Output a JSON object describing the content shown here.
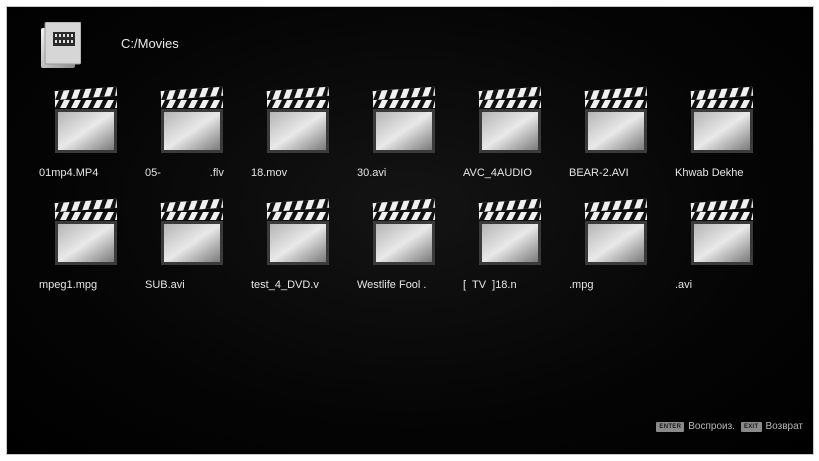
{
  "header": {
    "folder_icon": "folder-video-icon",
    "path": "C:/Movies"
  },
  "files": [
    {
      "name": "01mp4.MP4",
      "icon": "movie-clapperboard-icon"
    },
    {
      "name": "05-                .flv",
      "icon": "movie-clapperboard-icon"
    },
    {
      "name": "18.mov",
      "icon": "movie-clapperboard-icon"
    },
    {
      "name": "30.avi",
      "icon": "movie-clapperboard-icon"
    },
    {
      "name": "AVC_4AUDIO",
      "icon": "movie-clapperboard-icon"
    },
    {
      "name": "BEAR-2.AVI",
      "icon": "movie-clapperboard-icon"
    },
    {
      "name": "Khwab Dekhe",
      "icon": "movie-clapperboard-icon"
    },
    {
      "name": "mpeg1.mpg",
      "icon": "movie-clapperboard-icon"
    },
    {
      "name": "SUB.avi",
      "icon": "movie-clapperboard-icon"
    },
    {
      "name": "test_4_DVD.v",
      "icon": "movie-clapperboard-icon"
    },
    {
      "name": "Westlife Fool .",
      "icon": "movie-clapperboard-icon"
    },
    {
      "name": "[  TV  ]18.n",
      "icon": "movie-clapperboard-icon"
    },
    {
      "name": ".mpg",
      "icon": "movie-clapperboard-icon"
    },
    {
      "name": ".avi",
      "icon": "movie-clapperboard-icon"
    }
  ],
  "footer": {
    "enter_key": "ENTER",
    "enter_label": "Воспроиз.",
    "exit_key": "EXIT",
    "exit_label": "Возврат"
  },
  "colors": {
    "background": "#000000",
    "text": "#e6e6e6",
    "footer_text": "#b9b9b9"
  }
}
